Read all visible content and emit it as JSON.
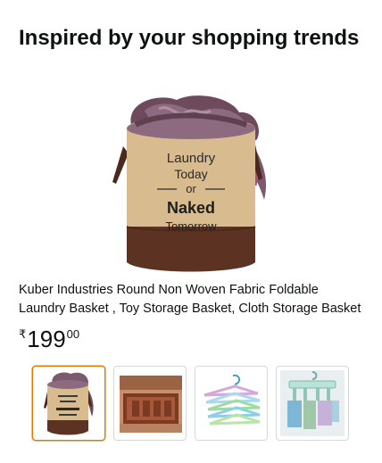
{
  "widget": {
    "heading": "Inspired by your shopping trends"
  },
  "product": {
    "image_label": {
      "line1": "Laundry",
      "line2": "Today",
      "line3": "or",
      "line4": "Naked",
      "line5": "Tomorrow"
    },
    "title": "Kuber Industries Round Non Woven Fabric Foldable Laundry Basket , Toy Storage Basket, Cloth Storage Basket",
    "price": {
      "symbol": "₹",
      "whole": "199",
      "fraction": "00"
    }
  },
  "thumbnails": [
    {
      "name": "laundry-basket",
      "selected": true
    },
    {
      "name": "door-mat",
      "selected": false
    },
    {
      "name": "hangers",
      "selected": false
    },
    {
      "name": "clip-hanger",
      "selected": false
    }
  ],
  "colors": {
    "selected_border": "#e77600",
    "basket_top": "#d8bb8f",
    "basket_bottom": "#5c3223"
  }
}
